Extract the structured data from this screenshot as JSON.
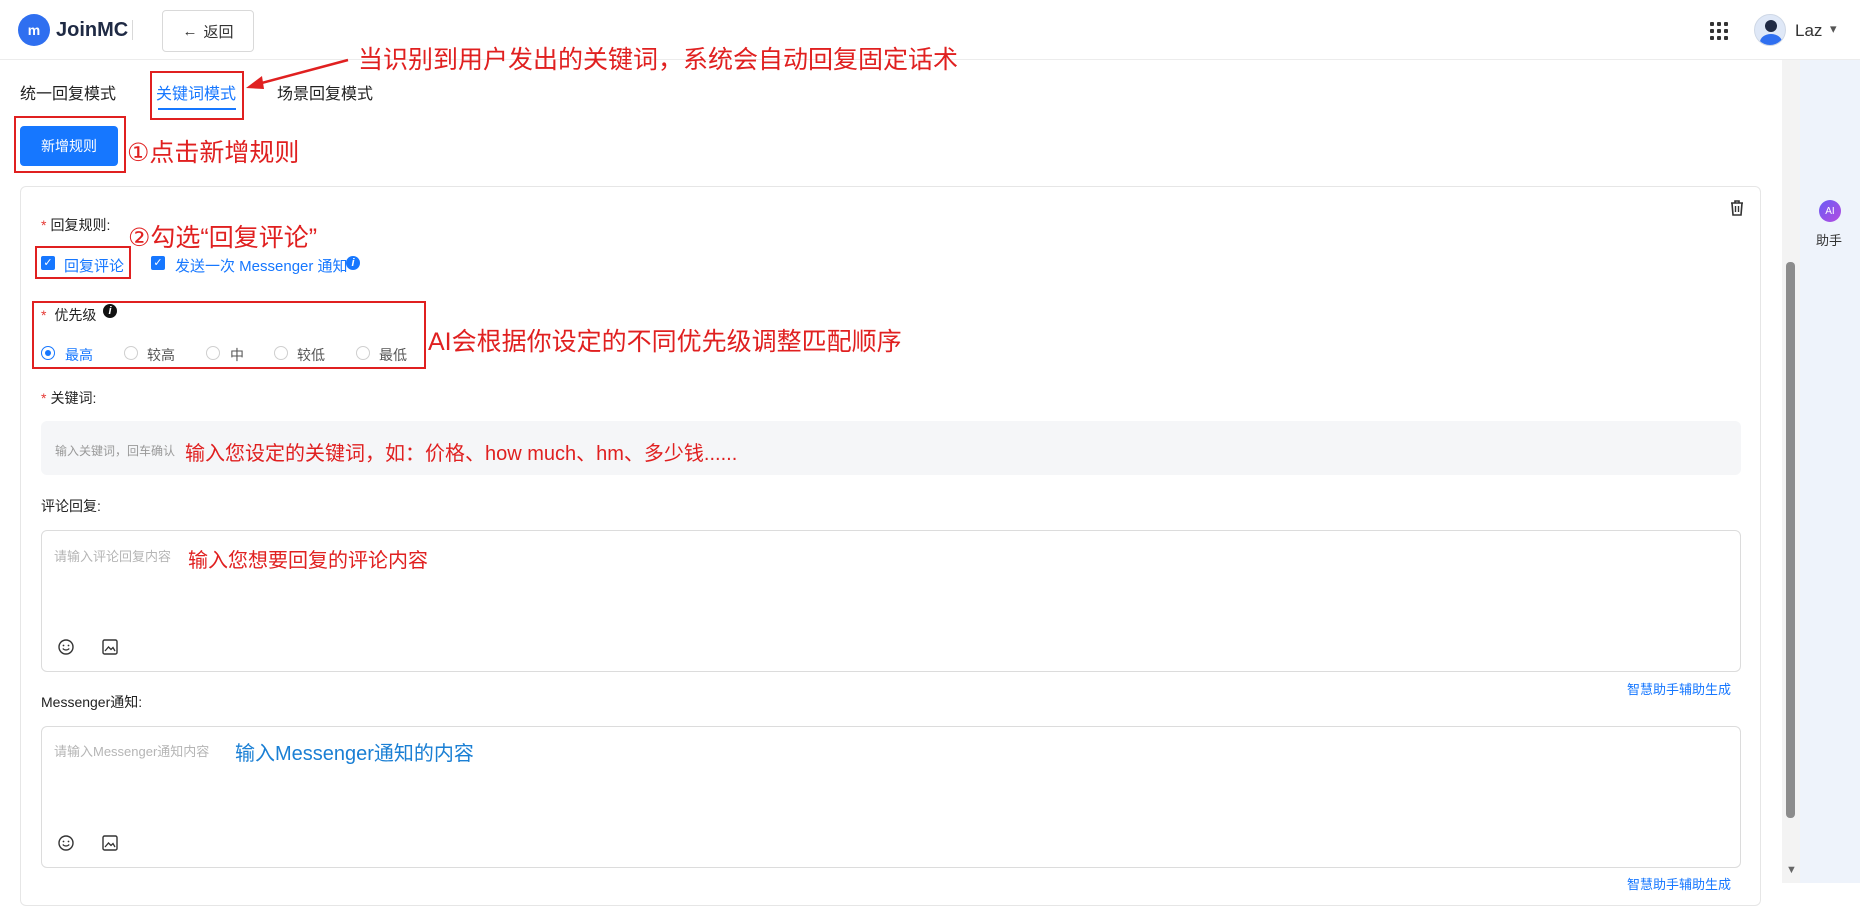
{
  "app": {
    "name": "JoinMC",
    "back_label": "返回",
    "user_name": "Laz"
  },
  "assistant": {
    "label": "助手",
    "badge": "AI"
  },
  "tabs": [
    {
      "label": "统一回复模式",
      "active": false
    },
    {
      "label": "关键词模式",
      "active": true
    },
    {
      "label": "场景回复模式",
      "active": false
    }
  ],
  "add_rule_label": "新增规则",
  "form": {
    "rule_label": "回复规则:",
    "rule_options": [
      {
        "label": "回复评论",
        "checked": true
      },
      {
        "label": "发送一次 Messenger 通知",
        "checked": true
      }
    ],
    "priority_label": "优先级",
    "priority_options": [
      {
        "label": "最高",
        "selected": true
      },
      {
        "label": "较高",
        "selected": false
      },
      {
        "label": "中",
        "selected": false
      },
      {
        "label": "较低",
        "selected": false
      },
      {
        "label": "最低",
        "selected": false
      }
    ],
    "keyword_label": "关键词:",
    "keyword_placeholder": "输入关键词，回车确认",
    "comment_reply_label": "评论回复:",
    "comment_reply_placeholder": "请输入评论回复内容",
    "assist_link_1": "智慧助手辅助生成",
    "messenger_label": "Messenger通知:",
    "messenger_placeholder": "请输入Messenger通知内容",
    "assist_link_2": "智慧助手辅助生成"
  },
  "annotations": {
    "mode_note": "当识别到用户发出的关键词，系统会自动回复固定话术",
    "step1": "①点击新增规则",
    "step2": "②勾选“回复评论”",
    "priority_note": "AI会根据你设定的不同优先级调整匹配顺序",
    "keyword_note": "输入您设定的关键词，如：价格、how much、hm、多少钱......",
    "comment_note": "输入您想要回复的评论内容",
    "messenger_note": "输入Messenger通知的内容"
  },
  "colors": {
    "primary": "#1677ff",
    "annotation_red": "#e02020",
    "annotation_blue": "#1a7fd4"
  }
}
